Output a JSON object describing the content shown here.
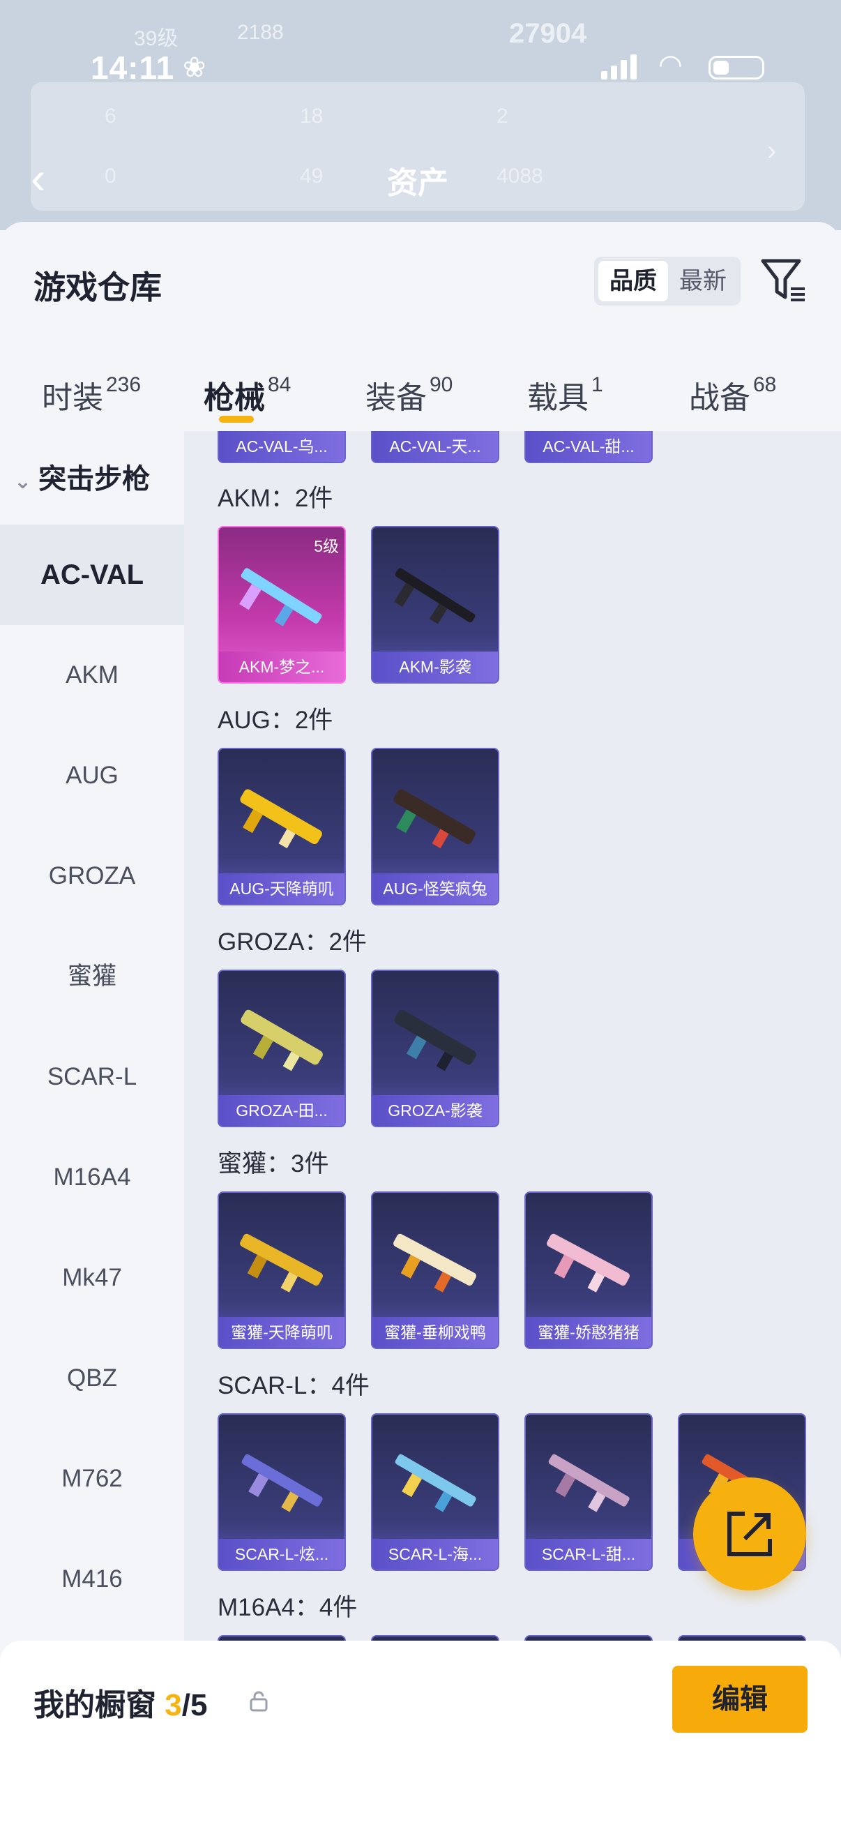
{
  "background": {
    "status_time": "14:11",
    "page_title": "资产",
    "stats": {
      "row0_left": "39级",
      "row0_mid": "2188",
      "row0_right": "27904",
      "row1": [
        "6",
        "18",
        "2"
      ],
      "row2": [
        "0",
        "49",
        "4088"
      ]
    }
  },
  "sheet": {
    "title": "游戏仓库",
    "sort_options": [
      "品质",
      "最新"
    ],
    "tabs": [
      {
        "label": "时装",
        "count": "236"
      },
      {
        "label": "枪械",
        "count": "84"
      },
      {
        "label": "装备",
        "count": "90"
      },
      {
        "label": "载具",
        "count": "1"
      },
      {
        "label": "战备",
        "count": "68"
      }
    ],
    "active_tab": "枪械"
  },
  "sidebar": {
    "category": "突击步枪",
    "items": [
      "AC-VAL",
      "AKM",
      "AUG",
      "GROZA",
      "蜜獾",
      "SCAR-L",
      "M16A4",
      "Mk47",
      "QBZ",
      "M762",
      "M416"
    ],
    "active": "AC-VAL"
  },
  "content": {
    "top_partial_cards": [
      "AC-VAL-乌...",
      "AC-VAL-天...",
      "AC-VAL-甜..."
    ],
    "groups": [
      {
        "title": "AKM：2件",
        "cards": [
          {
            "name": "AKM-梦之...",
            "level": "5级",
            "rarity": "pink"
          },
          {
            "name": "AKM-影袭",
            "rarity": "purple"
          }
        ]
      },
      {
        "title": "AUG：2件",
        "cards": [
          {
            "name": "AUG-天降萌叽",
            "rarity": "purple"
          },
          {
            "name": "AUG-怪笑疯兔",
            "rarity": "purple"
          }
        ]
      },
      {
        "title": "GROZA：2件",
        "cards": [
          {
            "name": "GROZA-田...",
            "rarity": "purple"
          },
          {
            "name": "GROZA-影袭",
            "rarity": "purple"
          }
        ]
      },
      {
        "title": "蜜獾：3件",
        "cards": [
          {
            "name": "蜜獾-天降萌叽",
            "rarity": "purple"
          },
          {
            "name": "蜜獾-垂柳戏鸭",
            "rarity": "purple"
          },
          {
            "name": "蜜獾-娇憨猪猪",
            "rarity": "purple"
          }
        ]
      },
      {
        "title": "SCAR-L：4件",
        "cards": [
          {
            "name": "SCAR-L-炫...",
            "rarity": "purple"
          },
          {
            "name": "SCAR-L-海...",
            "rarity": "purple"
          },
          {
            "name": "SCAR-L-甜...",
            "rarity": "purple"
          },
          {
            "name": "S",
            "rarity": "purple"
          }
        ]
      },
      {
        "title": "M16A4：4件",
        "cards": []
      }
    ]
  },
  "bottom": {
    "showcase_prefix": "我的橱窗",
    "showcase_count": "3",
    "showcase_total": "/5",
    "edit_label": "编辑"
  },
  "colors": {
    "accent": "#f7ab0a",
    "card_purple": "#3a3d7a",
    "card_pink": "#c43aac"
  }
}
